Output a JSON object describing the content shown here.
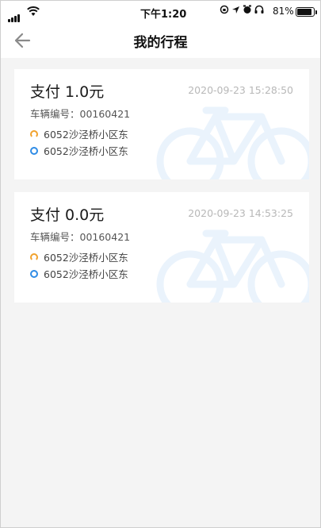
{
  "status_bar": {
    "time": "下午1:20",
    "battery_percent": "81%",
    "battery_level": 0.81
  },
  "header": {
    "title": "我的行程",
    "back_icon": "arrow-left-icon"
  },
  "trips": [
    {
      "payment": "支付 1.0元",
      "datetime": "2020-09-23 15:28:50",
      "bike_number": "车辆编号：00160421",
      "start": "6052沙泾桥小区东",
      "end": "6052沙泾桥小区东"
    },
    {
      "payment": "支付 0.0元",
      "datetime": "2020-09-23 14:53:25",
      "bike_number": "车辆编号：00160421",
      "start": "6052沙泾桥小区东",
      "end": "6052沙泾桥小区东"
    }
  ],
  "colors": {
    "start_marker": "#f1a22d",
    "end_marker": "#2f8ce6",
    "bike_watermark": "#e9f2fb"
  }
}
